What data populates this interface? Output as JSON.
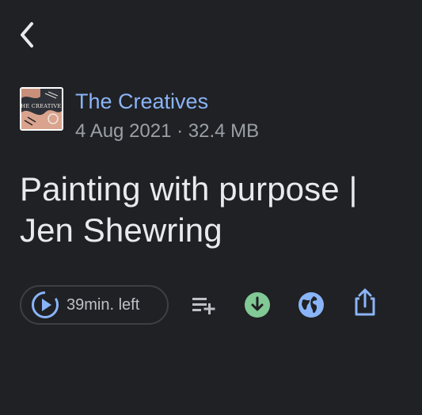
{
  "nav": {
    "back_icon": "chevron-left-icon"
  },
  "podcast": {
    "artwork_text": "THE CREATIVES",
    "name": "The Creatives",
    "date": "4 Aug 2021",
    "separator": "·",
    "size": "32.4 MB"
  },
  "episode": {
    "title": "Painting with purpose | Jen Shewring"
  },
  "controls": {
    "play_label": "39min. left",
    "play_icon": "play-progress-icon",
    "queue_icon": "add-to-queue-icon",
    "download_icon": "download-icon",
    "web_icon": "globe-icon",
    "share_icon": "share-icon"
  },
  "colors": {
    "background": "#202124",
    "accent_blue": "#8ab4f8",
    "download_green": "#81c995",
    "secondary_text": "#9aa0a6"
  }
}
